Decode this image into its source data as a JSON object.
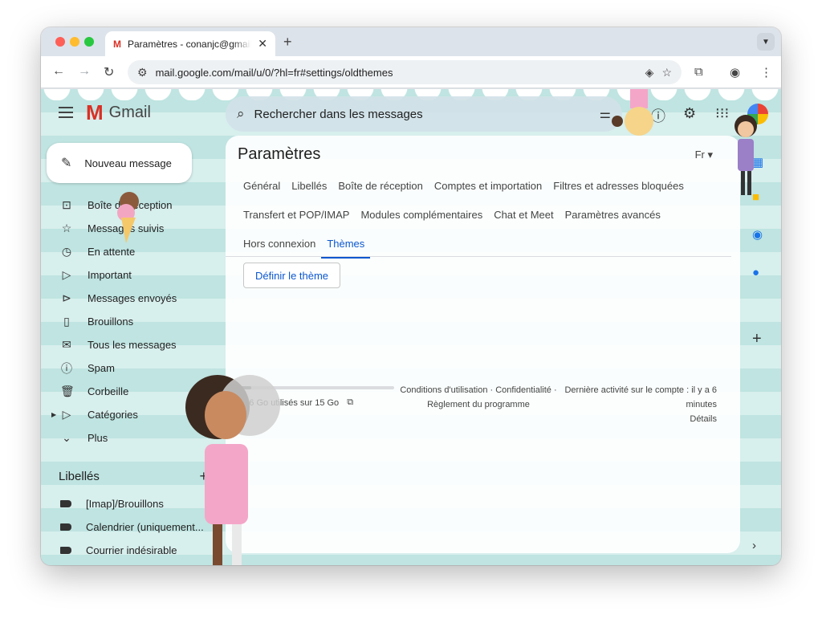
{
  "browser": {
    "tab_title": "Paramètres - conanjc@gmail.",
    "url": "mail.google.com/mail/u/0/?hl=fr#settings/oldthemes"
  },
  "gmail": {
    "app_name": "Gmail",
    "search_placeholder": "Rechercher dans les messages",
    "compose_label": "Nouveau message",
    "nav": [
      {
        "label": "Boîte de réception",
        "icon": "inbox-icon"
      },
      {
        "label": "Messages suivis",
        "icon": "star-icon"
      },
      {
        "label": "En attente",
        "icon": "clock-icon"
      },
      {
        "label": "Important",
        "icon": "important-icon"
      },
      {
        "label": "Messages envoyés",
        "icon": "send-icon"
      },
      {
        "label": "Brouillons",
        "icon": "draft-icon"
      },
      {
        "label": "Tous les messages",
        "icon": "all-mail-icon"
      },
      {
        "label": "Spam",
        "icon": "spam-icon"
      },
      {
        "label": "Corbeille",
        "icon": "trash-icon"
      },
      {
        "label": "Catégories",
        "icon": "label-outline-icon"
      },
      {
        "label": "Plus",
        "icon": "chevron-down-icon"
      }
    ],
    "labels_heading": "Libellés",
    "labels": [
      "[Imap]/Brouillons",
      "Calendrier (uniquement...",
      "Courrier indésirable"
    ]
  },
  "settings": {
    "title": "Paramètres",
    "language": "Fr",
    "tabs_row1": [
      "Général",
      "Libellés",
      "Boîte de réception",
      "Comptes et importation",
      "Filtres et adresses bloquées"
    ],
    "tabs_row2": [
      "Transfert et POP/IMAP",
      "Modules complémentaires",
      "Chat et Meet",
      "Paramètres avancés"
    ],
    "tabs_row3": [
      "Hors connexion",
      "Thèmes"
    ],
    "active_tab": "Thèmes",
    "set_theme_button": "Définir le thème",
    "storage_text": "1,36 Go utilisés sur 15 Go",
    "storage_fraction": 0.09,
    "footer": {
      "terms": "Conditions d'utilisation · Confidentialité ·",
      "program_policy": "Règlement du programme",
      "last_activity": "Dernière activité sur le compte : il y a 6 minutes",
      "details": "Détails"
    }
  },
  "colors": {
    "accent": "#0b57d0",
    "gmail_red": "#d93025",
    "theme_stripe_dark": "#bfe4e1",
    "theme_stripe_light": "#d7efed"
  }
}
